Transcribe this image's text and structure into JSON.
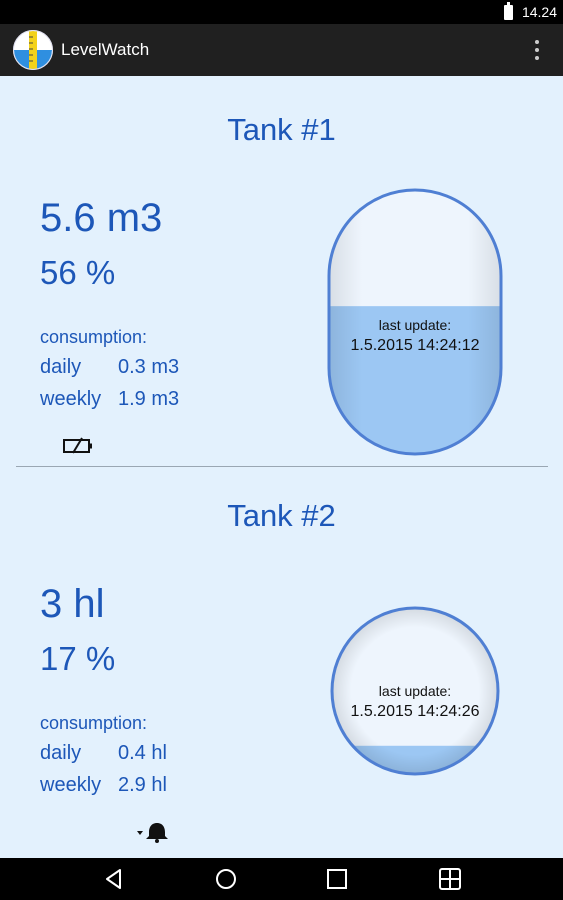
{
  "status_bar": {
    "time": "14.24"
  },
  "app_bar": {
    "title": "LevelWatch"
  },
  "tanks": [
    {
      "title": "Tank #1",
      "volume": "5.6 m3",
      "percent": "56 %",
      "fill_level": 0.56,
      "consumption_label": "consumption:",
      "daily_label": "daily",
      "daily_value": "0.3 m3",
      "weekly_label": "weekly",
      "weekly_value": "1.9 m3",
      "status_icon": "battery-empty-icon",
      "last_update_label": "last update:",
      "last_update_value": "1.5.2015 14:24:12"
    },
    {
      "title": "Tank #2",
      "volume": "3 hl",
      "percent": "17 %",
      "fill_level": 0.17,
      "consumption_label": "consumption:",
      "daily_label": "daily",
      "daily_value": "0.4 hl",
      "weekly_label": "weekly",
      "weekly_value": "2.9 hl",
      "status_icon": "alarm-bell-icon",
      "last_update_label": "last update:",
      "last_update_value": "1.5.2015 14:24:26"
    }
  ],
  "colors": {
    "accent": "#1d57b8",
    "background": "#e3f1fd",
    "liquid": "#9cc7f3",
    "gauge_border": "#4f7fd3"
  }
}
